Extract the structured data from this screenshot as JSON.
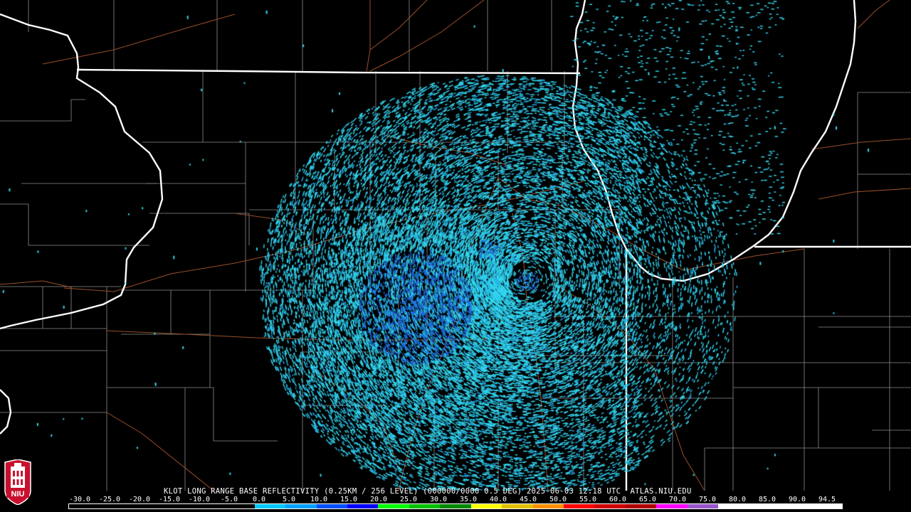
{
  "caption": "KLOT LONG RANGE BASE REFLECTIVITY (0.25KM / 256 LEVEL) (000000/0000 0.5 DEG) 2025-06-03 12:18 UTC  ATLAS.NIU.EDU",
  "logo": {
    "text": "NIU",
    "icon": "university-tower-icon"
  },
  "scale": {
    "labels": [
      "-30.0",
      "-25.0",
      "-20.0",
      "-15.0",
      "-10.0",
      "-5.0",
      "0.0",
      "5.0",
      "10.0",
      "15.0",
      "20.0",
      "25.0",
      "30.0",
      "35.0",
      "40.0",
      "45.0",
      "50.0",
      "55.0",
      "60.0",
      "65.0",
      "70.0",
      "75.0",
      "80.0",
      "85.0",
      "90.0",
      "94.5"
    ],
    "colors": [
      "#000000",
      "#000000",
      "#000000",
      "#000000",
      "#000000",
      "#000000",
      "#00c8ff",
      "#00a0ff",
      "#0050ff",
      "#0000ff",
      "#00ff00",
      "#00c000",
      "#008800",
      "#ffff00",
      "#e0c000",
      "#ff9000",
      "#ff0000",
      "#d00000",
      "#b00000",
      "#ff00ff",
      "#9955c9",
      "#ffffff",
      "#ffffff",
      "#ffffff",
      "#ffffff"
    ]
  },
  "colors": {
    "background": "#000000",
    "state_border": "#ffffff",
    "county_line": "#8c8c8c",
    "road_line": "#a0522d",
    "echo_light": "#33d6ef",
    "echo_mid": "#22aee8",
    "echo_dense": "#1f6fe0"
  }
}
